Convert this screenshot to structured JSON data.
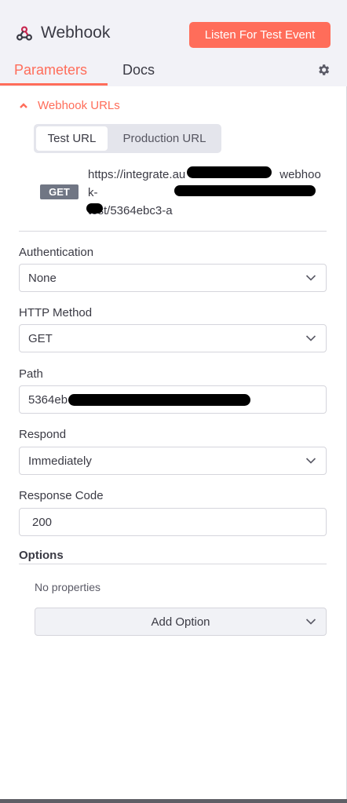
{
  "header": {
    "title": "Webhook",
    "listen_button": "Listen For Test Event",
    "app_icon": "webhook-icon",
    "settings_icon": "gear-icon",
    "accent_color": "#ff6d5a"
  },
  "tabs": [
    {
      "label": "Parameters",
      "active": true
    },
    {
      "label": "Docs",
      "active": false
    }
  ],
  "webhook_urls": {
    "section_label": "Webhook URLs",
    "toggle_test": "Test URL",
    "toggle_prod": "Production URL",
    "method": "GET",
    "url_line1": "https://integrate.au",
    "url_line1_tail": "webhook-",
    "url_line2": "test/5364ebc3-a"
  },
  "fields": {
    "authentication": {
      "label": "Authentication",
      "value": "None"
    },
    "http_method": {
      "label": "HTTP Method",
      "value": "GET"
    },
    "path": {
      "label": "Path",
      "value": "5364eb"
    },
    "respond": {
      "label": "Respond",
      "value": "Immediately"
    },
    "response_code": {
      "label": "Response Code",
      "value": "200"
    }
  },
  "options": {
    "label": "Options",
    "empty_text": "No properties",
    "add_button": "Add Option"
  }
}
